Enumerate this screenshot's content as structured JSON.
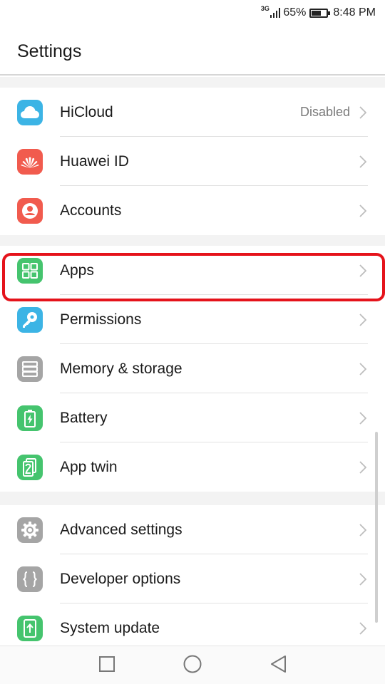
{
  "status_bar": {
    "network": "3G",
    "battery_percent": "65%",
    "battery_level": 0.65,
    "time": "8:48 PM"
  },
  "header": {
    "title": "Settings"
  },
  "groups": [
    [
      {
        "label": "HiCloud",
        "value": "Disabled",
        "icon": "cloud-icon",
        "color": "#3cb4e5"
      },
      {
        "label": "Huawei ID",
        "value": "",
        "icon": "huawei-logo-icon",
        "color": "#f15b4e"
      },
      {
        "label": "Accounts",
        "value": "",
        "icon": "person-icon",
        "color": "#f15b4e"
      }
    ],
    [
      {
        "label": "Apps",
        "value": "",
        "icon": "grid-apps-icon",
        "color": "#45c46e"
      },
      {
        "label": "Permissions",
        "value": "",
        "icon": "key-icon",
        "color": "#3cb4e5"
      },
      {
        "label": "Memory & storage",
        "value": "",
        "icon": "storage-icon",
        "color": "#a5a5a5"
      },
      {
        "label": "Battery",
        "value": "",
        "icon": "battery-icon",
        "color": "#45c46e"
      },
      {
        "label": "App twin",
        "value": "",
        "icon": "app-twin-icon",
        "color": "#45c46e"
      }
    ],
    [
      {
        "label": "Advanced settings",
        "value": "",
        "icon": "gear-icon",
        "color": "#a5a5a5"
      },
      {
        "label": "Developer options",
        "value": "",
        "icon": "braces-icon",
        "color": "#a5a5a5"
      },
      {
        "label": "System update",
        "value": "",
        "icon": "system-update-icon",
        "color": "#45c46e"
      }
    ]
  ],
  "nav_bar": {
    "recents": "square-icon",
    "home": "circle-icon",
    "back": "triangle-back-icon"
  },
  "highlight": {
    "target": "Apps",
    "color": "#e5131b"
  }
}
